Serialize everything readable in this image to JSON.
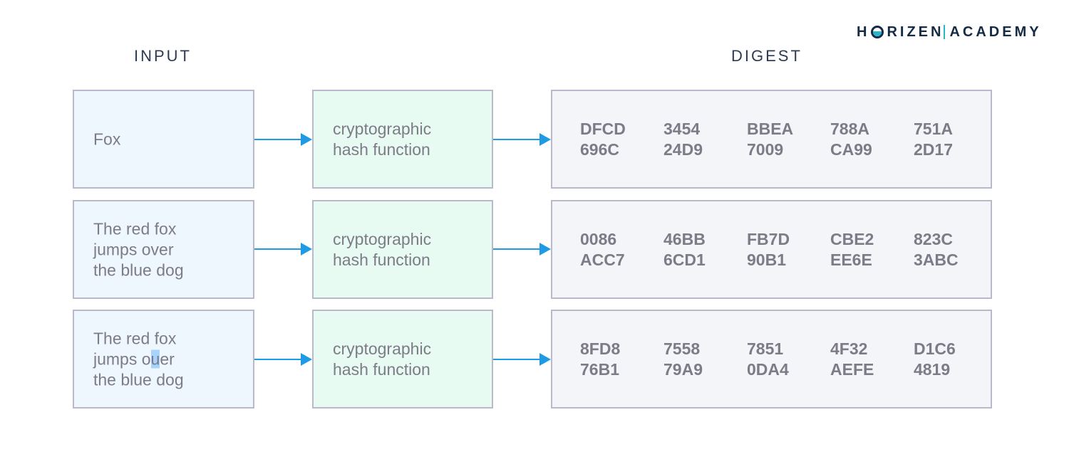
{
  "logo": {
    "part1_pre": "H",
    "part1_post": "RIZEN",
    "part2": "ACADEMY"
  },
  "headers": {
    "input": "INPUT",
    "digest": "DIGEST"
  },
  "rows": [
    {
      "input_lines": [
        "Fox"
      ],
      "function_lines": [
        "cryptographic",
        "hash function"
      ],
      "digest": [
        [
          "DFCD",
          "696C"
        ],
        [
          "3454",
          "24D9"
        ],
        [
          "BBEA",
          "7009"
        ],
        [
          "788A",
          "CA99"
        ],
        [
          "751A",
          "2D17"
        ]
      ]
    },
    {
      "input_lines": [
        "The red fox",
        "jumps over",
        "the blue dog"
      ],
      "function_lines": [
        "cryptographic",
        "hash function"
      ],
      "digest": [
        [
          "0086",
          "ACC7"
        ],
        [
          "46BB",
          "6CD1"
        ],
        [
          "FB7D",
          "90B1"
        ],
        [
          "CBE2",
          "EE6E"
        ],
        [
          "823C",
          "3ABC"
        ]
      ]
    },
    {
      "input_lines": [
        "The red fox",
        "jumps ouer",
        "the blue dog"
      ],
      "highlight": {
        "line": 1,
        "before": "jumps o",
        "mark": "u",
        "after": "er"
      },
      "function_lines": [
        "cryptographic",
        "hash function"
      ],
      "digest": [
        [
          "8FD8",
          "76B1"
        ],
        [
          "7558",
          "79A9"
        ],
        [
          "7851",
          "0DA4"
        ],
        [
          "4F32",
          "AEFE"
        ],
        [
          "D1C6",
          "4819"
        ]
      ]
    }
  ],
  "colors": {
    "arrow": "#1e9be4",
    "highlight": "#a8d3fb",
    "logo_accent": "#2bb3c9"
  }
}
